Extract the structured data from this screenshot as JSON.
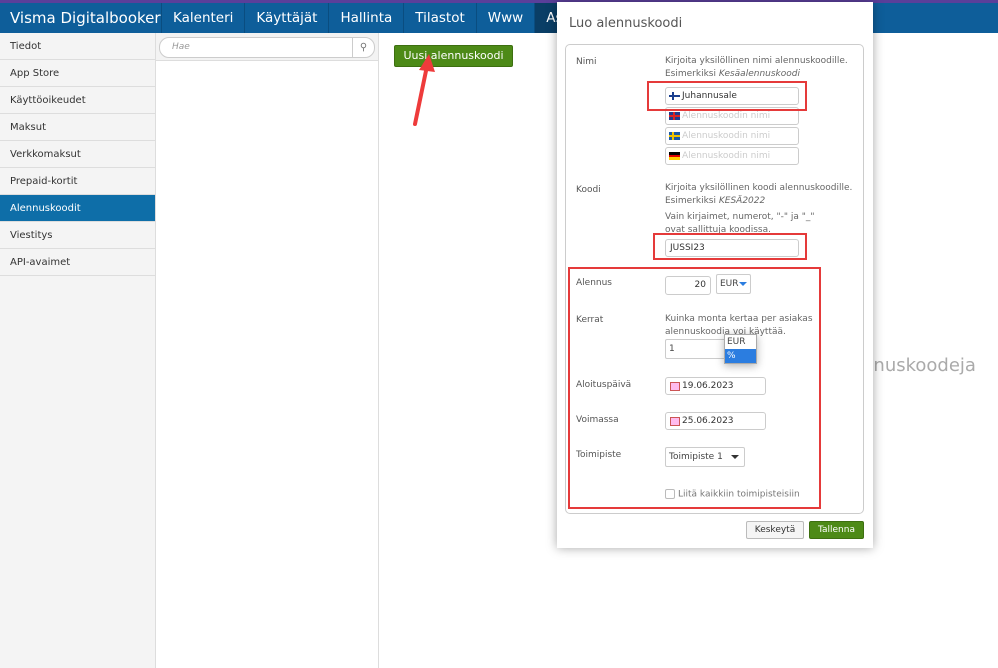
{
  "nav": {
    "brand": "Visma Digitalbooker",
    "items": [
      "Kalenteri",
      "Käyttäjät",
      "Hallinta",
      "Tilastot",
      "Www",
      "Asetukset"
    ]
  },
  "sidebar": {
    "items": [
      "Tiedot",
      "App Store",
      "Käyttöoikeudet",
      "Maksut",
      "Verkkomaksut",
      "Prepaid-kortit",
      "Alennuskoodit",
      "Viestitys",
      "API-avaimet"
    ],
    "active": "Alennuskoodit"
  },
  "search": {
    "placeholder": "Hae"
  },
  "main": {
    "new_button": "Uusi alennuskoodi",
    "background_text": "nnuskoodeja"
  },
  "modal": {
    "title": "Luo alennuskoodi",
    "name": {
      "label": "Nimi",
      "help": "Kirjoita yksilöllinen nimi alennuskoodille.",
      "example_prefix": "Esimerkiksi ",
      "example": "Kesäalennuskoodi",
      "fi_value": "Juhannusale",
      "placeholder": "Alennuskoodin nimi"
    },
    "code": {
      "label": "Koodi",
      "help": "Kirjoita yksilöllinen koodi alennuskoodille.",
      "example_prefix": "Esimerkiksi ",
      "example": "KESÄ2022",
      "rule": "Vain kirjaimet, numerot, \"-\" ja \"_\" ovat sallittuja koodissa.",
      "value": "JUSSI23"
    },
    "discount": {
      "label": "Alennus",
      "value": "20",
      "unit": "EUR",
      "options": [
        "EUR",
        "%"
      ],
      "highlighted": "%"
    },
    "times": {
      "label": "Kerrat",
      "help": "Kuinka monta kertaa per asiakas alennuskoodia voi käyttää.",
      "value": "1"
    },
    "start": {
      "label": "Aloituspäivä",
      "value": "19.06.2023"
    },
    "valid": {
      "label": "Voimassa",
      "value": "25.06.2023"
    },
    "location": {
      "label": "Toimipiste",
      "value": "Toimipiste 1",
      "attach_all": "Liitä kaikkiin toimipisteisiin",
      "attach_checked": false
    },
    "cancel": "Keskeytä",
    "save": "Tallenna"
  },
  "colors": {
    "nav": "#0e5e9a",
    "active": "#0e6ea8",
    "green": "#4d8a17",
    "highlight": "#e53a3a"
  }
}
